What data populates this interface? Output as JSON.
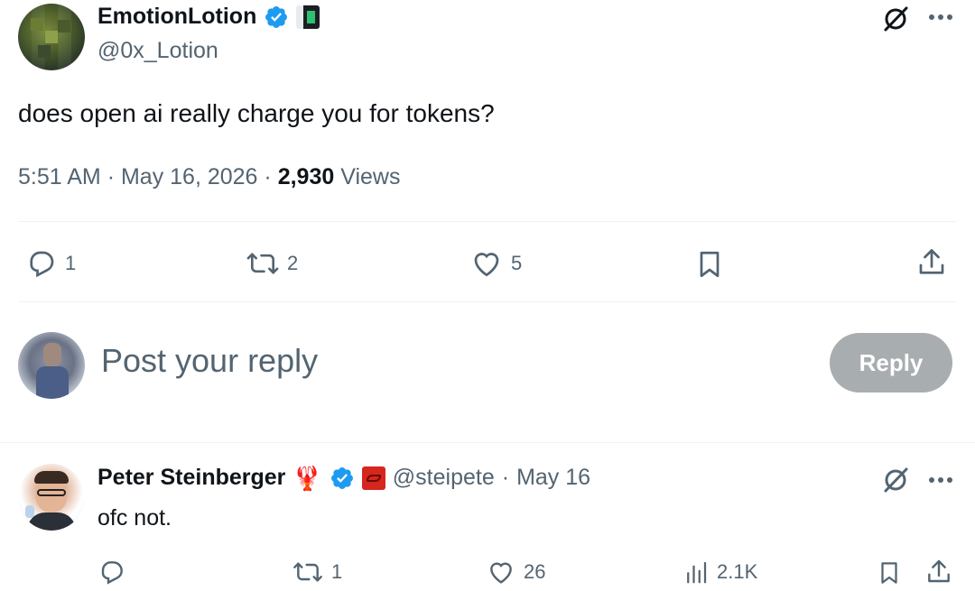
{
  "tweet": {
    "author": {
      "display_name": "EmotionLotion",
      "handle": "@0x_Lotion"
    },
    "text": "does open ai really charge you for tokens?",
    "time": "5:51 AM",
    "separator": "·",
    "date": "May 16, 2026",
    "views_count": "2,930",
    "views_label": "Views",
    "actions": {
      "replies": "1",
      "reposts": "2",
      "likes": "5"
    },
    "icons": [
      "grok-icon",
      "more-icon",
      "reply-icon",
      "repost-icon",
      "like-icon",
      "bookmark-icon",
      "share-icon",
      "verified-badge-icon"
    ]
  },
  "composer": {
    "placeholder": "Post your reply",
    "reply_label": "Reply"
  },
  "reply": {
    "author": {
      "display_name": "Peter Steinberger",
      "emoji": "🦞",
      "handle": "@steipete",
      "separator": "·",
      "date": "May 16"
    },
    "text": "ofc not.",
    "actions": {
      "replies": "",
      "reposts": "1",
      "likes": "26",
      "views": "2.1K"
    }
  },
  "colors": {
    "text_primary": "#0f1419",
    "text_secondary": "#536471",
    "verified_blue": "#1d9bf0",
    "divider": "#eff3f4",
    "reply_button": "#8c9296"
  }
}
